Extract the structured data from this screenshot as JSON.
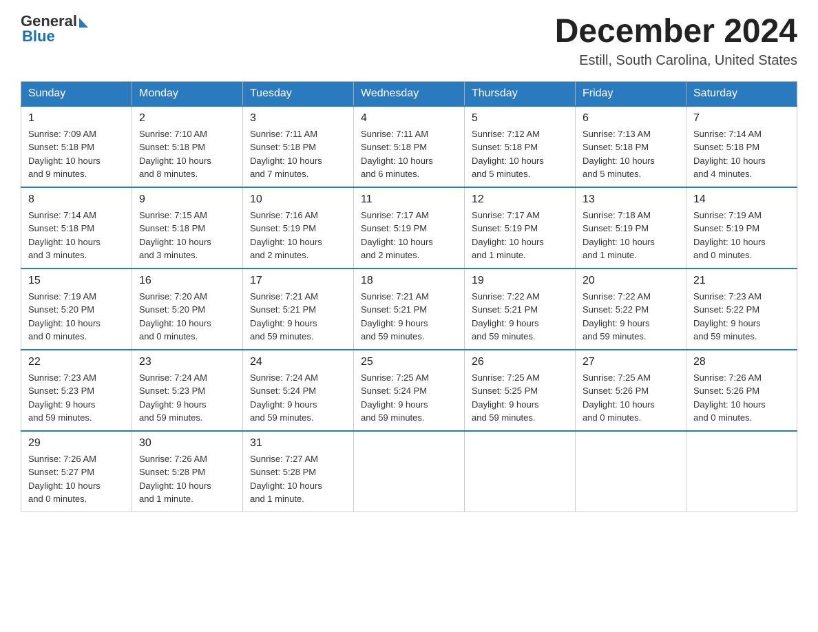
{
  "header": {
    "logo_text_1": "General",
    "logo_text_2": "Blue",
    "month_year": "December 2024",
    "location": "Estill, South Carolina, United States"
  },
  "days_of_week": [
    "Sunday",
    "Monday",
    "Tuesday",
    "Wednesday",
    "Thursday",
    "Friday",
    "Saturday"
  ],
  "weeks": [
    [
      {
        "day": "1",
        "sunrise": "7:09 AM",
        "sunset": "5:18 PM",
        "daylight": "10 hours and 9 minutes."
      },
      {
        "day": "2",
        "sunrise": "7:10 AM",
        "sunset": "5:18 PM",
        "daylight": "10 hours and 8 minutes."
      },
      {
        "day": "3",
        "sunrise": "7:11 AM",
        "sunset": "5:18 PM",
        "daylight": "10 hours and 7 minutes."
      },
      {
        "day": "4",
        "sunrise": "7:11 AM",
        "sunset": "5:18 PM",
        "daylight": "10 hours and 6 minutes."
      },
      {
        "day": "5",
        "sunrise": "7:12 AM",
        "sunset": "5:18 PM",
        "daylight": "10 hours and 5 minutes."
      },
      {
        "day": "6",
        "sunrise": "7:13 AM",
        "sunset": "5:18 PM",
        "daylight": "10 hours and 5 minutes."
      },
      {
        "day": "7",
        "sunrise": "7:14 AM",
        "sunset": "5:18 PM",
        "daylight": "10 hours and 4 minutes."
      }
    ],
    [
      {
        "day": "8",
        "sunrise": "7:14 AM",
        "sunset": "5:18 PM",
        "daylight": "10 hours and 3 minutes."
      },
      {
        "day": "9",
        "sunrise": "7:15 AM",
        "sunset": "5:18 PM",
        "daylight": "10 hours and 3 minutes."
      },
      {
        "day": "10",
        "sunrise": "7:16 AM",
        "sunset": "5:19 PM",
        "daylight": "10 hours and 2 minutes."
      },
      {
        "day": "11",
        "sunrise": "7:17 AM",
        "sunset": "5:19 PM",
        "daylight": "10 hours and 2 minutes."
      },
      {
        "day": "12",
        "sunrise": "7:17 AM",
        "sunset": "5:19 PM",
        "daylight": "10 hours and 1 minute."
      },
      {
        "day": "13",
        "sunrise": "7:18 AM",
        "sunset": "5:19 PM",
        "daylight": "10 hours and 1 minute."
      },
      {
        "day": "14",
        "sunrise": "7:19 AM",
        "sunset": "5:19 PM",
        "daylight": "10 hours and 0 minutes."
      }
    ],
    [
      {
        "day": "15",
        "sunrise": "7:19 AM",
        "sunset": "5:20 PM",
        "daylight": "10 hours and 0 minutes."
      },
      {
        "day": "16",
        "sunrise": "7:20 AM",
        "sunset": "5:20 PM",
        "daylight": "10 hours and 0 minutes."
      },
      {
        "day": "17",
        "sunrise": "7:21 AM",
        "sunset": "5:21 PM",
        "daylight": "9 hours and 59 minutes."
      },
      {
        "day": "18",
        "sunrise": "7:21 AM",
        "sunset": "5:21 PM",
        "daylight": "9 hours and 59 minutes."
      },
      {
        "day": "19",
        "sunrise": "7:22 AM",
        "sunset": "5:21 PM",
        "daylight": "9 hours and 59 minutes."
      },
      {
        "day": "20",
        "sunrise": "7:22 AM",
        "sunset": "5:22 PM",
        "daylight": "9 hours and 59 minutes."
      },
      {
        "day": "21",
        "sunrise": "7:23 AM",
        "sunset": "5:22 PM",
        "daylight": "9 hours and 59 minutes."
      }
    ],
    [
      {
        "day": "22",
        "sunrise": "7:23 AM",
        "sunset": "5:23 PM",
        "daylight": "9 hours and 59 minutes."
      },
      {
        "day": "23",
        "sunrise": "7:24 AM",
        "sunset": "5:23 PM",
        "daylight": "9 hours and 59 minutes."
      },
      {
        "day": "24",
        "sunrise": "7:24 AM",
        "sunset": "5:24 PM",
        "daylight": "9 hours and 59 minutes."
      },
      {
        "day": "25",
        "sunrise": "7:25 AM",
        "sunset": "5:24 PM",
        "daylight": "9 hours and 59 minutes."
      },
      {
        "day": "26",
        "sunrise": "7:25 AM",
        "sunset": "5:25 PM",
        "daylight": "9 hours and 59 minutes."
      },
      {
        "day": "27",
        "sunrise": "7:25 AM",
        "sunset": "5:26 PM",
        "daylight": "10 hours and 0 minutes."
      },
      {
        "day": "28",
        "sunrise": "7:26 AM",
        "sunset": "5:26 PM",
        "daylight": "10 hours and 0 minutes."
      }
    ],
    [
      {
        "day": "29",
        "sunrise": "7:26 AM",
        "sunset": "5:27 PM",
        "daylight": "10 hours and 0 minutes."
      },
      {
        "day": "30",
        "sunrise": "7:26 AM",
        "sunset": "5:28 PM",
        "daylight": "10 hours and 1 minute."
      },
      {
        "day": "31",
        "sunrise": "7:27 AM",
        "sunset": "5:28 PM",
        "daylight": "10 hours and 1 minute."
      },
      null,
      null,
      null,
      null
    ]
  ],
  "labels": {
    "sunrise": "Sunrise:",
    "sunset": "Sunset:",
    "daylight": "Daylight:"
  }
}
